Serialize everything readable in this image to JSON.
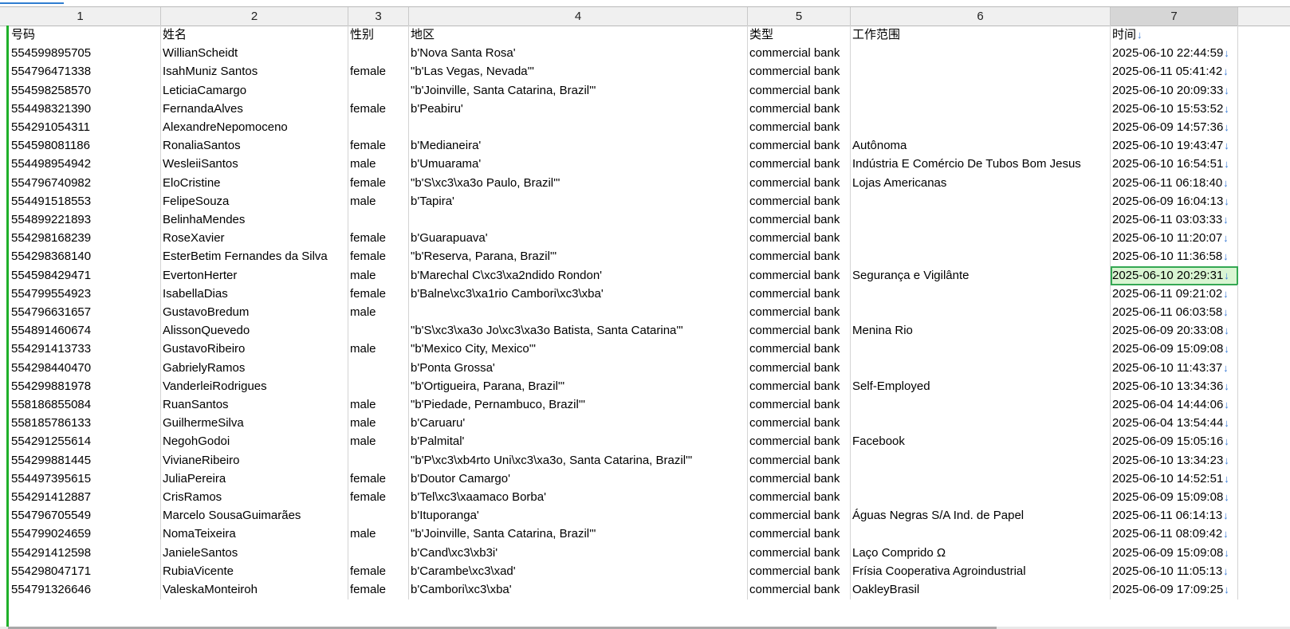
{
  "columns": [
    "1",
    "2",
    "3",
    "4",
    "5",
    "6",
    "7"
  ],
  "headers": [
    "号码",
    "姓名",
    "性别",
    "地区",
    "类型",
    "工作范围",
    "时间"
  ],
  "sort_arrow": "↓",
  "rows": [
    [
      "554599895705",
      "WillianScheidt",
      "",
      "b'Nova Santa Rosa'",
      "commercial bank",
      "",
      "2025-06-10 22:44:59"
    ],
    [
      "554796471338",
      "IsahMuniz Santos",
      "female",
      "\"b'Las Vegas, Nevada'\"",
      "commercial bank",
      "",
      "2025-06-11 05:41:42"
    ],
    [
      "554598258570",
      "LeticiaCamargo",
      "",
      "\"b'Joinville, Santa Catarina, Brazil'\"",
      "commercial bank",
      "",
      "2025-06-10 20:09:33"
    ],
    [
      "554498321390",
      "FernandaAlves",
      "female",
      "b'Peabiru'",
      "commercial bank",
      "",
      "2025-06-10 15:53:52"
    ],
    [
      "554291054311",
      "AlexandreNepomoceno",
      "",
      "",
      "commercial bank",
      "",
      "2025-06-09 14:57:36"
    ],
    [
      "554598081186",
      "RonaliaSantos",
      "female",
      "b'Medianeira'",
      "commercial bank",
      "Autônoma",
      "2025-06-10 19:43:47"
    ],
    [
      "554498954942",
      "WesleiiSantos",
      "male",
      "b'Umuarama'",
      "commercial bank",
      "Indústria E Comércio De Tubos Bom Jesus",
      "2025-06-10 16:54:51"
    ],
    [
      "554796740982",
      "EloCristine",
      "female",
      "\"b'S\\xc3\\xa3o Paulo, Brazil'\"",
      "commercial bank",
      "Lojas Americanas",
      "2025-06-11 06:18:40"
    ],
    [
      "554491518553",
      "FelipeSouza",
      "male",
      "b'Tapira'",
      "commercial bank",
      "",
      "2025-06-09 16:04:13"
    ],
    [
      "554899221893",
      "BelinhaMendes",
      "",
      "",
      "commercial bank",
      "",
      "2025-06-11 03:03:33"
    ],
    [
      "554298168239",
      "RoseXavier",
      "female",
      "b'Guarapuava'",
      "commercial bank",
      "",
      "2025-06-10 11:20:07"
    ],
    [
      "554298368140",
      "EsterBetim Fernandes da Silva",
      "female",
      "\"b'Reserva, Parana, Brazil'\"",
      "commercial bank",
      "",
      "2025-06-10 11:36:58"
    ],
    [
      "554598429471",
      "EvertonHerter",
      "male",
      "b'Marechal C\\xc3\\xa2ndido Rondon'",
      "commercial bank",
      "Segurança e Vigilânte",
      "2025-06-10 20:29:31"
    ],
    [
      "554799554923",
      "IsabellaDias",
      "female",
      "b'Balne\\xc3\\xa1rio Cambori\\xc3\\xba'",
      "commercial bank",
      "",
      "2025-06-11 09:21:02"
    ],
    [
      "554796631657",
      "GustavoBredum",
      "male",
      "",
      "commercial bank",
      "",
      "2025-06-11 06:03:58"
    ],
    [
      "554891460674",
      "AlissonQuevedo",
      "",
      "\"b'S\\xc3\\xa3o Jo\\xc3\\xa3o Batista, Santa Catarina'\"",
      "commercial bank",
      "Menina Rio",
      "2025-06-09 20:33:08"
    ],
    [
      "554291413733",
      "GustavoRibeiro",
      "male",
      "\"b'Mexico City, Mexico'\"",
      "commercial bank",
      "",
      "2025-06-09 15:09:08"
    ],
    [
      "554298440470",
      "GabrielyRamos",
      "",
      "b'Ponta Grossa'",
      "commercial bank",
      "",
      "2025-06-10 11:43:37"
    ],
    [
      "554299881978",
      "VanderleiRodrigues",
      "",
      "\"b'Ortigueira, Parana, Brazil'\"",
      "commercial bank",
      "Self-Employed",
      "2025-06-10 13:34:36"
    ],
    [
      "558186855084",
      "RuanSantos",
      "male",
      "\"b'Piedade, Pernambuco, Brazil'\"",
      "commercial bank",
      "",
      "2025-06-04 14:44:06"
    ],
    [
      "558185786133",
      "GuilhermeSilva",
      "male",
      "b'Caruaru'",
      "commercial bank",
      "",
      "2025-06-04 13:54:44"
    ],
    [
      "554291255614",
      "NegohGodoi",
      "male",
      "b'Palmital'",
      "commercial bank",
      "Facebook",
      "2025-06-09 15:05:16"
    ],
    [
      "554299881445",
      "VivianeRibeiro",
      "",
      "\"b'P\\xc3\\xb4rto Uni\\xc3\\xa3o, Santa Catarina, Brazil'\"",
      "commercial bank",
      "",
      "2025-06-10 13:34:23"
    ],
    [
      "554497395615",
      "JuliaPereira",
      "female",
      "b'Doutor Camargo'",
      "commercial bank",
      "",
      "2025-06-10 14:52:51"
    ],
    [
      "554291412887",
      "CrisRamos",
      "female",
      "b'Tel\\xc3\\xaamaco Borba'",
      "commercial bank",
      "",
      "2025-06-09 15:09:08"
    ],
    [
      "554796705549",
      "Marcelo SousaGuimarães",
      "",
      "b'Ituporanga'",
      "commercial bank",
      "Águas Negras S/A Ind. de Papel",
      "2025-06-11 06:14:13"
    ],
    [
      "554799024659",
      "NomaTeixeira",
      "male",
      "\"b'Joinville, Santa Catarina, Brazil'\"",
      "commercial bank",
      "",
      "2025-06-11 08:09:42"
    ],
    [
      "554291412598",
      "JanieleSantos",
      "",
      "b'Cand\\xc3\\xb3i'",
      "commercial bank",
      "Laço Comprido Ω",
      "2025-06-09 15:09:08"
    ],
    [
      "554298047171",
      "RubiaVicente",
      "female",
      "b'Carambe\\xc3\\xad'",
      "commercial bank",
      "Frísia Cooperativa Agroindustrial",
      "2025-06-10 11:05:13"
    ],
    [
      "554791326646",
      "ValeskaMonteiroh",
      "female",
      "b'Cambori\\xc3\\xba'",
      "commercial bank",
      "OakleyBrasil",
      "2025-06-09 17:09:25"
    ]
  ],
  "selected_row": 12,
  "colors": {
    "row_bar": "#1fb02a",
    "selection": "#d9f5d2",
    "arrow": "#3a7bd5"
  }
}
